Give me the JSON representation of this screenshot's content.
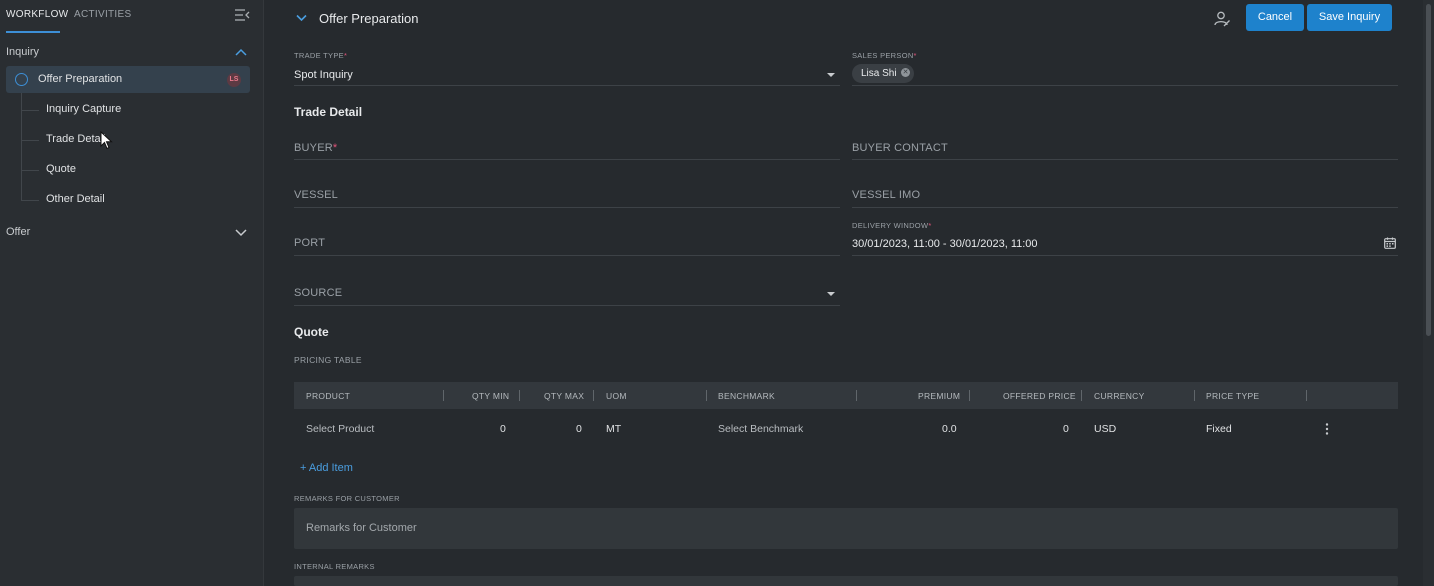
{
  "sidebar": {
    "tabs": [
      {
        "label": "WORKFLOW",
        "active": true
      },
      {
        "label": "ACTIVITIES",
        "active": false
      }
    ],
    "sections": [
      {
        "label": "Inquiry",
        "expanded": true,
        "items": [
          {
            "label": "Offer Preparation",
            "active": true,
            "badge": "LS"
          },
          {
            "label": "Inquiry Capture"
          },
          {
            "label": "Trade Detail"
          },
          {
            "label": "Quote"
          },
          {
            "label": "Other Detail"
          }
        ]
      },
      {
        "label": "Offer",
        "expanded": false
      }
    ]
  },
  "header": {
    "title": "Offer Preparation",
    "cancel_label": "Cancel",
    "save_label": "Save Inquiry"
  },
  "form": {
    "trade_type": {
      "label": "TRADE TYPE",
      "required": "*",
      "value": "Spot Inquiry"
    },
    "sales_person": {
      "label": "SALES PERSON",
      "required": "*",
      "chip": "Lisa Shi"
    },
    "trade_detail_title": "Trade Detail",
    "buyer": {
      "label": "BUYER",
      "required": "*"
    },
    "buyer_contact": {
      "label": "BUYER CONTACT"
    },
    "vessel": {
      "label": "VESSEL"
    },
    "vessel_imo": {
      "label": "VESSEL IMO"
    },
    "port": {
      "label": "PORT"
    },
    "delivery_window": {
      "label": "DELIVERY WINDOW",
      "required": "*",
      "value": "30/01/2023, 11:00 - 30/01/2023, 11:00"
    },
    "source": {
      "label": "SOURCE"
    },
    "quote_title": "Quote",
    "pricing_table_label": "PRICING TABLE"
  },
  "pricing_table": {
    "columns": [
      "PRODUCT",
      "QTY MIN",
      "QTY MAX",
      "UOM",
      "BENCHMARK",
      "PREMIUM",
      "OFFERED PRICE",
      "CURRENCY",
      "PRICE TYPE"
    ],
    "rows": [
      {
        "product": "Select Product",
        "qty_min": "0",
        "qty_max": "0",
        "uom": "MT",
        "benchmark": "Select Benchmark",
        "premium": "0.0",
        "offered_price": "0",
        "currency": "USD",
        "price_type": "Fixed"
      }
    ],
    "add_item_label": "+ Add Item"
  },
  "remarks": {
    "customer_label": "REMARKS FOR CUSTOMER",
    "customer_placeholder": "Remarks for Customer",
    "internal_label": "INTERNAL REMARKS"
  },
  "colors": {
    "accent": "#1e82cc",
    "background": "#262a2e",
    "sidebar": "#2a2e32",
    "required": "#e2557a"
  }
}
